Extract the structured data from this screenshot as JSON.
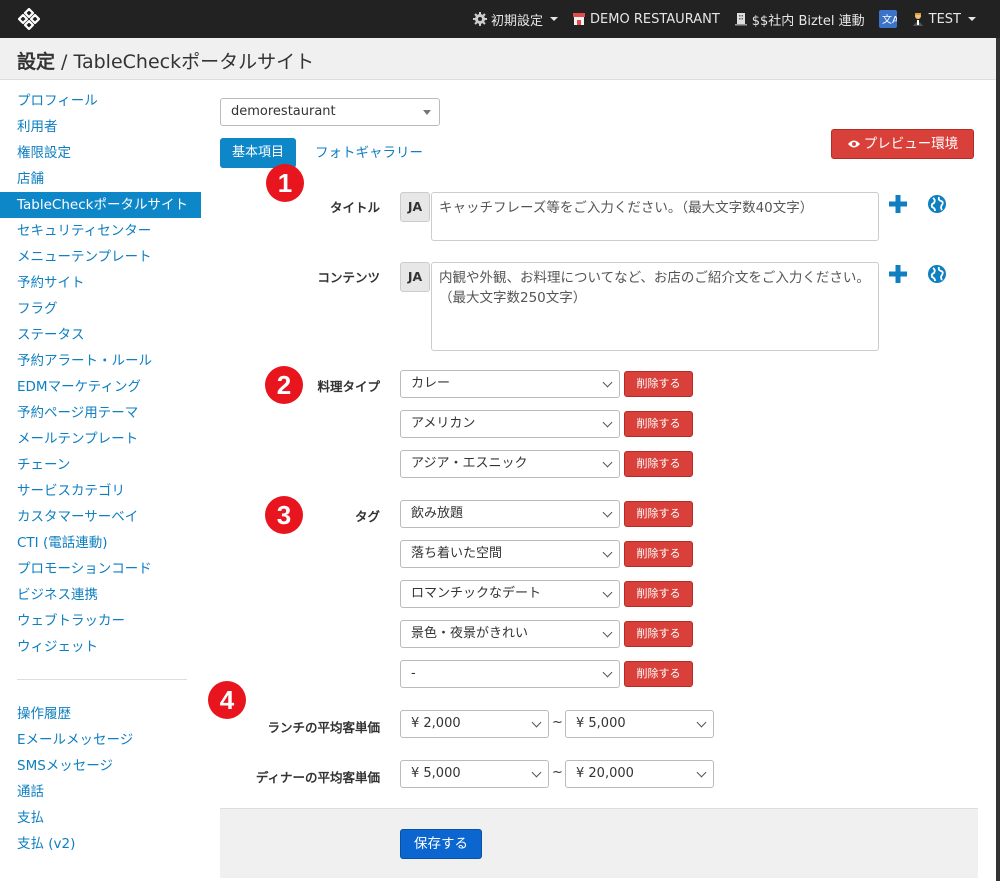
{
  "navbar": {
    "settings_label": "初期設定",
    "restaurant_label": "DEMO RESTAURANT",
    "biztel_label": "$$社内 Biztel 連動",
    "translate_label": "文A",
    "user_label": "TEST"
  },
  "header": {
    "title_bold": "設定",
    "title_rest": " / TableCheckポータルサイト"
  },
  "sidebar": {
    "items": [
      {
        "label": "プロフィール"
      },
      {
        "label": "利用者"
      },
      {
        "label": "権限設定"
      },
      {
        "label": "店舗"
      },
      {
        "label": "TableCheckポータルサイト"
      },
      {
        "label": "セキュリティセンター"
      },
      {
        "label": "メニューテンプレート"
      },
      {
        "label": "予約サイト"
      },
      {
        "label": "フラグ"
      },
      {
        "label": "ステータス"
      },
      {
        "label": "予約アラート・ルール"
      },
      {
        "label": "EDMマーケティング"
      },
      {
        "label": "予約ページ用テーマ"
      },
      {
        "label": "メールテンプレート"
      },
      {
        "label": "チェーン"
      },
      {
        "label": "サービスカテゴリ"
      },
      {
        "label": "カスタマーサーベイ"
      },
      {
        "label": "CTI (電話連動)"
      },
      {
        "label": "プロモーションコード"
      },
      {
        "label": "ビジネス連携"
      },
      {
        "label": "ウェブトラッカー"
      },
      {
        "label": "ウィジェット"
      }
    ],
    "items2": [
      {
        "label": "操作履歴"
      },
      {
        "label": "Eメールメッセージ"
      },
      {
        "label": "SMSメッセージ"
      },
      {
        "label": "通話"
      },
      {
        "label": "支払"
      },
      {
        "label": "支払 (v2)"
      }
    ]
  },
  "main": {
    "shop_select": "demorestaurant",
    "tabs": {
      "basic": "基本項目",
      "photo": "フォトギャラリー"
    },
    "preview_button": "プレビュー環境",
    "badges": [
      "1",
      "2",
      "3",
      "4"
    ],
    "title_field": {
      "label": "タイトル",
      "lang": "JA",
      "placeholder": "キャッチフレーズ等をご入力ください。（最大文字数40文字）"
    },
    "contents_field": {
      "label": "コンテンツ",
      "lang": "JA",
      "placeholder": "内観や外観、お料理についてなど、お店のご紹介文をご入力ください。（最大文字数250文字）"
    },
    "cuisine": {
      "label": "料理タイプ",
      "values": [
        "カレー",
        "アメリカン",
        "アジア・エスニック"
      ]
    },
    "tags": {
      "label": "タグ",
      "values": [
        "飲み放題",
        "落ち着いた空間",
        "ロマンチックなデート",
        "景色・夜景がきれい",
        "-"
      ]
    },
    "delete_label": "削除する",
    "lunch": {
      "label": "ランチの平均客単価",
      "min": "¥ 2,000",
      "max": "¥ 5,000"
    },
    "dinner": {
      "label": "ディナーの平均客単価",
      "min": "¥ 5,000",
      "max": "¥ 20,000"
    },
    "tilde": "~",
    "save_button": "保存する"
  },
  "colors": {
    "navbar": "#222222",
    "link": "#0e7fc0",
    "active": "#0e87c9",
    "danger": "#d9403a",
    "badge": "#e8141e",
    "save": "#0b66d0"
  }
}
